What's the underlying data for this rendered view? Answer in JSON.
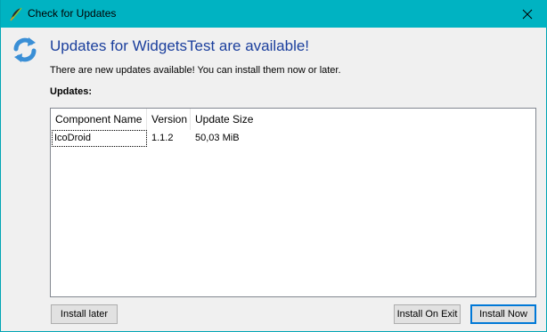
{
  "window": {
    "title": "Check for Updates",
    "app_icon": "feather-icon",
    "close_icon": "close-icon"
  },
  "header": {
    "icon": "refresh-arrows-icon",
    "title": "Updates for WidgetsTest are available!",
    "description": "There are new updates available! You can install them now or later."
  },
  "updates": {
    "label": "Updates:",
    "columns": [
      "Component Name",
      "Version",
      "Update Size"
    ],
    "rows": [
      [
        "IcoDroid",
        "1.1.2",
        "50,03 MiB"
      ]
    ]
  },
  "buttons": {
    "install_later": "Install later",
    "install_on_exit": "Install On Exit",
    "install_now": "Install Now"
  },
  "colors": {
    "titlebar": "#00b3c2",
    "heading": "#1b3f9d",
    "default_button_border": "#0078d7"
  }
}
